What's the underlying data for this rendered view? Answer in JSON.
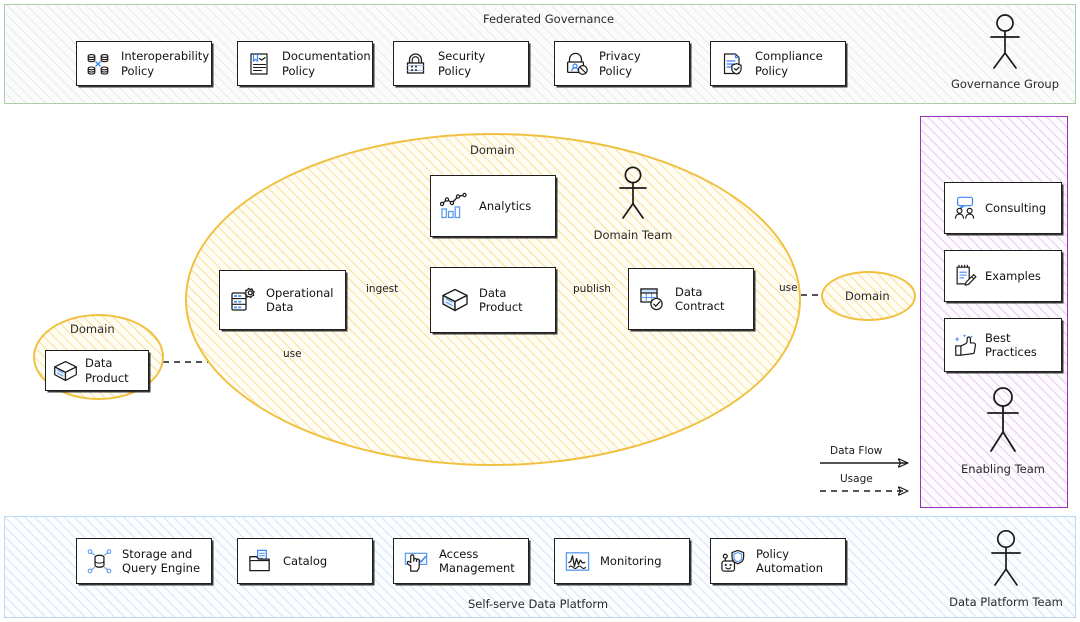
{
  "governance": {
    "title": "Federated Governance",
    "border_color": "#a9cfa9",
    "items": [
      {
        "label": "Interoperability\nPolicy",
        "icon": "databases-interop-icon"
      },
      {
        "label": "Documentation\nPolicy",
        "icon": "document-pen-icon"
      },
      {
        "label": "Security\nPolicy",
        "icon": "padlock-icon"
      },
      {
        "label": "Privacy\nPolicy",
        "icon": "privacy-lock-person-icon"
      },
      {
        "label": "Compliance\nPolicy",
        "icon": "document-shield-icon"
      }
    ],
    "actor": {
      "label": "Governance Group",
      "icon": "stick-figure-icon"
    }
  },
  "domain": {
    "label": "Domain",
    "border_color": "#f0c040",
    "nodes": [
      {
        "id": "analytics",
        "label": "Analytics",
        "icon": "analytics-chart-icon"
      },
      {
        "id": "operational-data",
        "label": "Operational\nData",
        "icon": "database-gear-icon"
      },
      {
        "id": "data-product",
        "label": "Data Product",
        "icon": "open-box-icon"
      },
      {
        "id": "data-contract",
        "label": "Data\nContract",
        "icon": "table-check-icon"
      }
    ],
    "actor": {
      "label": "Domain Team",
      "icon": "stick-figure-icon"
    },
    "edges": [
      {
        "from": "operational-data",
        "to": "data-product",
        "label": "ingest",
        "style": "solid"
      },
      {
        "from": "data-product",
        "to": "data-contract",
        "label": "publish",
        "style": "solid"
      },
      {
        "from": "analytics",
        "to": "data-product",
        "label": "",
        "style": "dashed"
      },
      {
        "from": "data-product",
        "to": "consumer-domain-data-product",
        "label": "use",
        "style": "dashed"
      },
      {
        "from": "consumer-domain-right",
        "to": "data-contract",
        "label": "use",
        "style": "dashed"
      }
    ]
  },
  "consumer_domain_left": {
    "label": "Domain",
    "node": {
      "label": "Data\nProduct",
      "icon": "open-box-icon"
    }
  },
  "consumer_domain_right": {
    "label": "Domain"
  },
  "enabling": {
    "border_color": "#9b31b4",
    "items": [
      {
        "label": "Consulting",
        "icon": "people-chat-icon"
      },
      {
        "label": "Examples",
        "icon": "notepad-pencil-icon"
      },
      {
        "label": "Best\nPractices",
        "icon": "thumbs-up-sparkle-icon"
      }
    ],
    "actor": {
      "label": "Enabling Team",
      "icon": "stick-figure-icon"
    }
  },
  "platform": {
    "title": "Self-serve Data Platform",
    "border_color": "#bcd9f2",
    "items": [
      {
        "label": "Storage and\nQuery Engine",
        "icon": "database-network-icon"
      },
      {
        "label": "Catalog",
        "icon": "folder-document-icon"
      },
      {
        "label": "Access\nManagement",
        "icon": "hand-check-icon"
      },
      {
        "label": "Monitoring",
        "icon": "waveform-monitor-icon"
      },
      {
        "label": "Policy\nAutomation",
        "icon": "robot-shield-icon"
      }
    ],
    "actor": {
      "label": "Data Platform Team",
      "icon": "stick-figure-icon"
    }
  },
  "legend": {
    "data_flow": "Data Flow",
    "usage": "Usage"
  }
}
